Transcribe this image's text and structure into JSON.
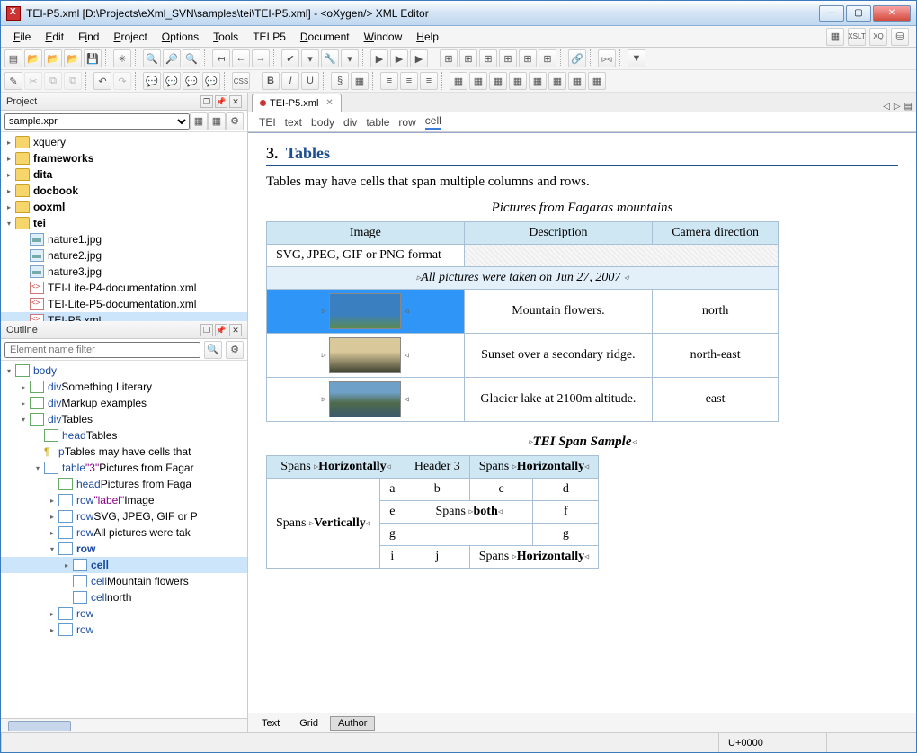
{
  "window": {
    "title": "TEI-P5.xml [D:\\Projects\\eXml_SVN\\samples\\tei\\TEI-P5.xml] - <oXygen/> XML Editor"
  },
  "menu": [
    "File",
    "Edit",
    "Find",
    "Project",
    "Options",
    "Tools",
    "TEI P5",
    "Document",
    "Window",
    "Help"
  ],
  "project": {
    "panel_title": "Project",
    "selector": "sample.xpr",
    "items": [
      {
        "type": "folder",
        "label": "xquery",
        "expanded": false
      },
      {
        "type": "folder",
        "label": "frameworks",
        "expanded": false,
        "bold": true
      },
      {
        "type": "folder",
        "label": "dita",
        "expanded": false,
        "bold": true
      },
      {
        "type": "folder",
        "label": "docbook",
        "expanded": false,
        "bold": true
      },
      {
        "type": "folder",
        "label": "ooxml",
        "expanded": false,
        "bold": true
      },
      {
        "type": "folder",
        "label": "tei",
        "expanded": true,
        "bold": true,
        "children": [
          {
            "type": "img",
            "label": "nature1.jpg"
          },
          {
            "type": "img",
            "label": "nature2.jpg"
          },
          {
            "type": "img",
            "label": "nature3.jpg"
          },
          {
            "type": "xml",
            "label": "TEI-Lite-P4-documentation.xml"
          },
          {
            "type": "xml",
            "label": "TEI-Lite-P5-documentation.xml"
          },
          {
            "type": "xml",
            "label": "TEI-P5.xml",
            "selected": true
          }
        ]
      }
    ]
  },
  "outline": {
    "panel_title": "Outline",
    "filter_placeholder": "Element name filter"
  },
  "outline_items": [
    {
      "depth": 0,
      "twisty": "▾",
      "icon": "el",
      "el": "body",
      "text": ""
    },
    {
      "depth": 1,
      "twisty": "▸",
      "icon": "el",
      "el": "div",
      "text": "Something Literary"
    },
    {
      "depth": 1,
      "twisty": "▸",
      "icon": "el",
      "el": "div",
      "text": "Markup examples"
    },
    {
      "depth": 1,
      "twisty": "▾",
      "icon": "el",
      "el": "div",
      "text": "Tables"
    },
    {
      "depth": 2,
      "twisty": " ",
      "icon": "el",
      "el": "head",
      "text": "Tables"
    },
    {
      "depth": 2,
      "twisty": " ",
      "icon": "el",
      "el": "p",
      "text": "Tables may have cells that",
      "pilcrow": true
    },
    {
      "depth": 2,
      "twisty": "▾",
      "icon": "tbl",
      "el": "table",
      "attr": "\"3\"",
      "text": "Pictures from Fagar"
    },
    {
      "depth": 3,
      "twisty": " ",
      "icon": "el",
      "el": "head",
      "text": "Pictures from Faga"
    },
    {
      "depth": 3,
      "twisty": "▸",
      "icon": "tbl",
      "el": "row",
      "attr": "\"label\"",
      "text": "Image"
    },
    {
      "depth": 3,
      "twisty": "▸",
      "icon": "tbl",
      "el": "row",
      "text": "SVG, JPEG, GIF or P"
    },
    {
      "depth": 3,
      "twisty": "▸",
      "icon": "tbl",
      "el": "row",
      "text": "All pictures were tak"
    },
    {
      "depth": 3,
      "twisty": "▾",
      "icon": "tbl",
      "el": "row",
      "text": "",
      "bold": true
    },
    {
      "depth": 4,
      "twisty": "▸",
      "icon": "tbl",
      "el": "cell",
      "text": "",
      "selected": true,
      "bold": true
    },
    {
      "depth": 4,
      "twisty": " ",
      "icon": "tbl",
      "el": "cell",
      "text": "Mountain flowers"
    },
    {
      "depth": 4,
      "twisty": " ",
      "icon": "tbl",
      "el": "cell",
      "text": "north"
    },
    {
      "depth": 3,
      "twisty": "▸",
      "icon": "tbl",
      "el": "row",
      "text": ""
    },
    {
      "depth": 3,
      "twisty": "▸",
      "icon": "tbl",
      "el": "row",
      "text": ""
    }
  ],
  "tabs": {
    "file": "TEI-P5.xml"
  },
  "breadcrumb": [
    "TEI",
    "text",
    "body",
    "div",
    "table",
    "row",
    "cell"
  ],
  "doc": {
    "heading_num": "3.",
    "heading": "Tables",
    "para": "Tables may have cells that span multiple columns and rows.",
    "caption1": "Pictures from Fagaras mountains",
    "headers1": [
      "Image",
      "Description",
      "Camera direction"
    ],
    "row_format": "SVG, JPEG, GIF or PNG format",
    "note": "All pictures were taken on Jun 27, 2007",
    "rows1": [
      {
        "desc": "Mountain flowers.",
        "dir": "north",
        "sel": true,
        "thumb": "t1"
      },
      {
        "desc": "Sunset over a secondary ridge.",
        "dir": "north-east",
        "thumb": "t2"
      },
      {
        "desc": "Glacier lake at 2100m altitude.",
        "dir": "east",
        "thumb": "t3"
      }
    ],
    "caption2": "TEI Span Sample",
    "span_h": "Horizontally",
    "spans_label": "Spans",
    "header3": "Header 3",
    "span_v": "Vertically",
    "span_both": "both",
    "cells2": {
      "r1": [
        "a",
        "b",
        "c",
        "d"
      ],
      "r2_e": "e",
      "r2_f": "f",
      "r3_g1": "g",
      "r3_g2": "g",
      "r4_i": "i",
      "r4_j": "j"
    }
  },
  "viewmodes": [
    "Text",
    "Grid",
    "Author"
  ],
  "status": {
    "unicode": "U+0000"
  }
}
